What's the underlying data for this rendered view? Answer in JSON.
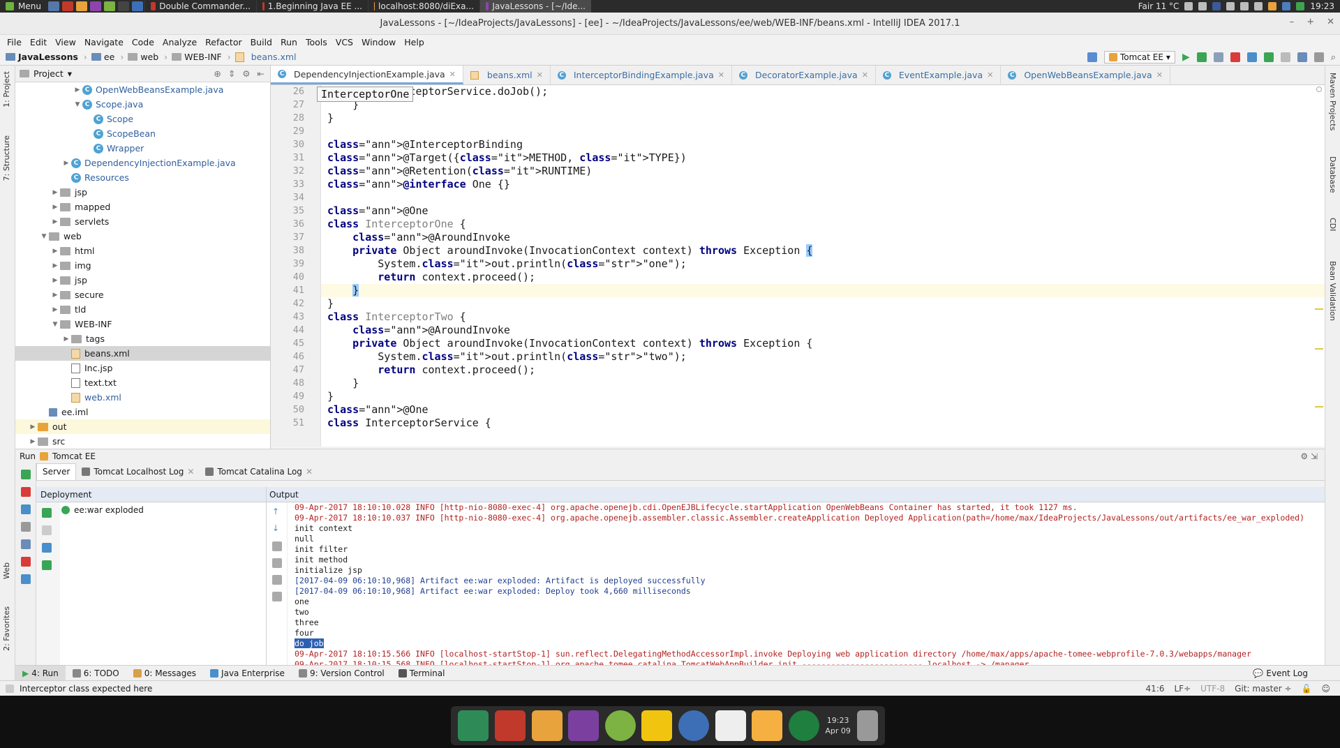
{
  "os_panel": {
    "menu_label": "Menu",
    "tasks": [
      {
        "label": "Double Commander..."
      },
      {
        "label": "1.Beginning Java EE ..."
      },
      {
        "label": "localhost:8080/diExa..."
      },
      {
        "label": "JavaLessons - [~/Ide..."
      }
    ],
    "weather": "Fair 11 °C",
    "clock": "19:23"
  },
  "window": {
    "title": "JavaLessons - [~/IdeaProjects/JavaLessons] - [ee] - ~/IdeaProjects/JavaLessons/ee/web/WEB-INF/beans.xml - IntelliJ IDEA 2017.1"
  },
  "menubar": [
    "File",
    "Edit",
    "View",
    "Navigate",
    "Code",
    "Analyze",
    "Refactor",
    "Build",
    "Run",
    "Tools",
    "VCS",
    "Window",
    "Help"
  ],
  "breadcrumb": [
    "JavaLessons",
    "ee",
    "web",
    "WEB-INF",
    "beans.xml"
  ],
  "run_config": "Tomcat EE",
  "project_panel": {
    "title": "Project",
    "tree": [
      {
        "label": "OpenWebBeansExample.java",
        "icon": "class-icon",
        "arrow": "▶",
        "blue": true
      },
      {
        "label": "Scope.java",
        "icon": "class-icon",
        "arrow": "▼",
        "blue": true
      },
      {
        "label": "Scope",
        "icon": "class-icon",
        "arrow": "",
        "blue": true
      },
      {
        "label": "ScopeBean",
        "icon": "class-icon",
        "arrow": "",
        "blue": true
      },
      {
        "label": "Wrapper",
        "icon": "class-icon",
        "arrow": "",
        "blue": true
      },
      {
        "label": "DependencyInjectionExample.java",
        "icon": "class-icon",
        "arrow": "▶",
        "blue": true
      },
      {
        "label": "Resources",
        "icon": "class-icon",
        "arrow": "",
        "blue": true
      },
      {
        "label": "jsp",
        "icon": "folder-icon",
        "arrow": "▶",
        "blue": false
      },
      {
        "label": "mapped",
        "icon": "folder-icon",
        "arrow": "▶",
        "blue": false
      },
      {
        "label": "servlets",
        "icon": "folder-icon",
        "arrow": "▶",
        "blue": false
      },
      {
        "label": "web",
        "icon": "folder-icon",
        "arrow": "▼",
        "blue": false
      },
      {
        "label": "html",
        "icon": "folder-icon",
        "arrow": "▶",
        "blue": false
      },
      {
        "label": "img",
        "icon": "folder-icon",
        "arrow": "▶",
        "blue": false
      },
      {
        "label": "jsp",
        "icon": "folder-icon",
        "arrow": "▶",
        "blue": false
      },
      {
        "label": "secure",
        "icon": "folder-icon",
        "arrow": "▶",
        "blue": false
      },
      {
        "label": "tld",
        "icon": "folder-icon",
        "arrow": "▶",
        "blue": false
      },
      {
        "label": "WEB-INF",
        "icon": "folder-icon",
        "arrow": "▼",
        "blue": false
      },
      {
        "label": "tags",
        "icon": "folder-icon",
        "arrow": "▶",
        "blue": false
      },
      {
        "label": "beans.xml",
        "icon": "xml-icon",
        "arrow": "",
        "blue": false,
        "selected": true
      },
      {
        "label": "Inc.jsp",
        "icon": "jsp-icon",
        "arrow": "",
        "blue": false
      },
      {
        "label": "text.txt",
        "icon": "text-icon",
        "arrow": "",
        "blue": false
      },
      {
        "label": "web.xml",
        "icon": "xml-icon",
        "arrow": "",
        "blue": true
      },
      {
        "label": "ee.iml",
        "icon": "module-icon",
        "arrow": "",
        "blue": false
      },
      {
        "label": "out",
        "icon": "folder-orange-icon",
        "arrow": "▶",
        "blue": false,
        "highlight": true
      },
      {
        "label": "src",
        "icon": "folder-icon",
        "arrow": "▶",
        "blue": false
      }
    ]
  },
  "editor_tabs": [
    {
      "label": "DependencyInjectionExample.java",
      "active": true
    },
    {
      "label": "beans.xml",
      "active": false
    },
    {
      "label": "InterceptorBindingExample.java",
      "active": false
    },
    {
      "label": "DecoratorExample.java",
      "active": false
    },
    {
      "label": "EventExample.java",
      "active": false
    },
    {
      "label": "OpenWebBeansExample.java",
      "active": false
    }
  ],
  "tooltip": "InterceptorOne",
  "code_lines": [
    {
      "n": "26",
      "html": "        interceptorService.doJob();"
    },
    {
      "n": "27",
      "html": "    }"
    },
    {
      "n": "28",
      "html": "}"
    },
    {
      "n": "29",
      "html": ""
    },
    {
      "n": "30",
      "html": "@InterceptorBinding"
    },
    {
      "n": "31",
      "html": "@Target({METHOD, TYPE})"
    },
    {
      "n": "32",
      "html": "@Retention(RUNTIME)"
    },
    {
      "n": "33",
      "html": "@interface One {}"
    },
    {
      "n": "34",
      "html": ""
    },
    {
      "n": "35",
      "html": "@One"
    },
    {
      "n": "36",
      "html": "class InterceptorOne {"
    },
    {
      "n": "37",
      "html": "    @AroundInvoke"
    },
    {
      "n": "38",
      "html": "    private Object aroundInvoke(InvocationContext context) throws Exception {"
    },
    {
      "n": "39",
      "html": "        System.out.println(\"one\");"
    },
    {
      "n": "40",
      "html": "        return context.proceed();"
    },
    {
      "n": "41",
      "html": "    }"
    },
    {
      "n": "42",
      "html": "}"
    },
    {
      "n": "43",
      "html": "class InterceptorTwo {"
    },
    {
      "n": "44",
      "html": "    @AroundInvoke"
    },
    {
      "n": "45",
      "html": "    private Object aroundInvoke(InvocationContext context) throws Exception {"
    },
    {
      "n": "46",
      "html": "        System.out.println(\"two\");"
    },
    {
      "n": "47",
      "html": "        return context.proceed();"
    },
    {
      "n": "48",
      "html": "    }"
    },
    {
      "n": "49",
      "html": "}"
    },
    {
      "n": "50",
      "html": "@One"
    },
    {
      "n": "51",
      "html": "class InterceptorService {"
    }
  ],
  "run_panel": {
    "title": "Run",
    "config": "Tomcat EE",
    "tabs": [
      "Server",
      "Tomcat Localhost Log",
      "Tomcat Catalina Log"
    ],
    "deployment_header": "Deployment",
    "deployment_item": "ee:war exploded",
    "output_header": "Output",
    "output": [
      {
        "t": "09-Apr-2017 18:10:10.028 INFO [http-nio-8080-exec-4] org.apache.openejb.cdi.OpenEJBLifecycle.startApplication OpenWebBeans Container has started, it took 1127 ms.",
        "c": "red"
      },
      {
        "t": "09-Apr-2017 18:10:10.037 INFO [http-nio-8080-exec-4] org.apache.openejb.assembler.classic.Assembler.createApplication Deployed Application(path=/home/max/IdeaProjects/JavaLessons/out/artifacts/ee_war_exploded)",
        "c": "red"
      },
      {
        "t": "init context",
        "c": ""
      },
      {
        "t": "null",
        "c": ""
      },
      {
        "t": "init filter",
        "c": ""
      },
      {
        "t": "init method",
        "c": ""
      },
      {
        "t": "initialize jsp",
        "c": ""
      },
      {
        "t": "[2017-04-09 06:10:10,968] Artifact ee:war exploded: Artifact is deployed successfully",
        "c": "blue"
      },
      {
        "t": "[2017-04-09 06:10:10,968] Artifact ee:war exploded: Deploy took 4,660 milliseconds",
        "c": "blue"
      },
      {
        "t": "one",
        "c": ""
      },
      {
        "t": "two",
        "c": ""
      },
      {
        "t": "three",
        "c": ""
      },
      {
        "t": "four",
        "c": ""
      },
      {
        "t": "do job",
        "c": "",
        "sel": true
      },
      {
        "t": "09-Apr-2017 18:10:15.566 INFO [localhost-startStop-1] sun.reflect.DelegatingMethodAccessorImpl.invoke Deploying web application directory /home/max/apps/apache-tomee-webprofile-7.0.3/webapps/manager",
        "c": "red"
      },
      {
        "t": "09-Apr-2017 18:10:15.568 INFO [localhost-startStop-1] org.apache.tomee.catalina.TomcatWebAppBuilder.init ------------------------- localhost -> /manager",
        "c": "red"
      }
    ]
  },
  "bottom_tabs": [
    "4: Run",
    "6: TODO",
    "0: Messages",
    "Java Enterprise",
    "9: Version Control",
    "Terminal"
  ],
  "event_log": "Event Log",
  "status": {
    "message": "Interceptor class expected here",
    "position": "41:6",
    "line_sep": "LF÷",
    "encoding": "UTF-8",
    "git": "Git: master ÷"
  },
  "left_strip": [
    "1: Project",
    "7: Structure",
    "Web",
    "2: Favorites"
  ],
  "right_strip": [
    "Maven Projects",
    "Database",
    "CDI",
    "Bean Validation"
  ],
  "dock_clock": {
    "time": "19:23",
    "date": "Apr 09"
  }
}
